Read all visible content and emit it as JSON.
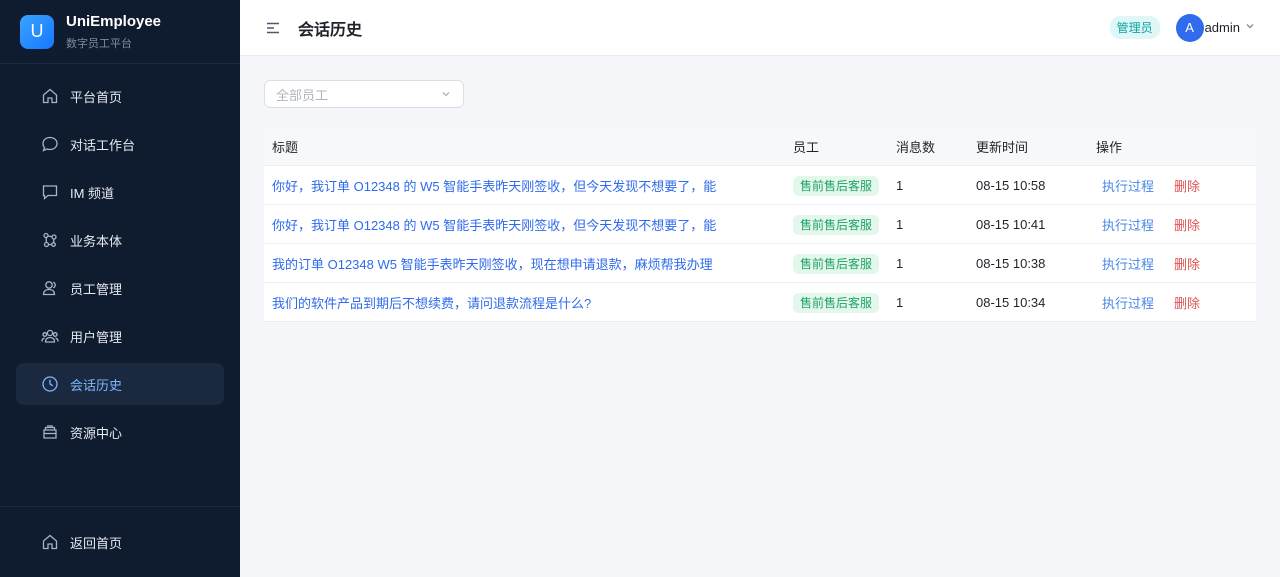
{
  "brand": {
    "logo_letter": "U",
    "name": "UniEmployee",
    "subtitle": "数字员工平台"
  },
  "sidebar": {
    "items": [
      {
        "label": "平台首页",
        "icon": "home-icon"
      },
      {
        "label": "对话工作台",
        "icon": "chat-bubble-icon"
      },
      {
        "label": "IM 频道",
        "icon": "message-square-icon"
      },
      {
        "label": "业务本体",
        "icon": "graph-nodes-icon"
      },
      {
        "label": "员工管理",
        "icon": "user-icon"
      },
      {
        "label": "用户管理",
        "icon": "users-icon"
      },
      {
        "label": "会话历史",
        "icon": "clock-icon",
        "active": true
      },
      {
        "label": "资源中心",
        "icon": "archive-icon"
      }
    ],
    "bottom": {
      "label": "返回首页",
      "icon": "home-icon"
    }
  },
  "header": {
    "title": "会话历史",
    "role_badge": "管理员",
    "avatar_letter": "A",
    "username": "admin"
  },
  "filter": {
    "placeholder": "全部员工"
  },
  "table": {
    "columns": [
      "标题",
      "员工",
      "消息数",
      "更新时间",
      "操作"
    ],
    "rows": [
      {
        "title": "你好，我订单 O12348 的 W5 智能手表昨天刚签收，但今天发现不想要了，能",
        "employee": "售前售后客服",
        "count": "1",
        "time": "08-15 10:58",
        "op_view": "执行过程",
        "op_delete": "删除"
      },
      {
        "title": "你好，我订单 O12348 的 W5 智能手表昨天刚签收，但今天发现不想要了，能",
        "employee": "售前售后客服",
        "count": "1",
        "time": "08-15 10:41",
        "op_view": "执行过程",
        "op_delete": "删除"
      },
      {
        "title": "我的订单 O12348 W5 智能手表昨天刚签收，现在想申请退款，麻烦帮我办理",
        "employee": "售前售后客服",
        "count": "1",
        "time": "08-15 10:38",
        "op_view": "执行过程",
        "op_delete": "删除"
      },
      {
        "title": "我们的软件产品到期后不想续费，请问退款流程是什么?",
        "employee": "售前售后客服",
        "count": "1",
        "time": "08-15 10:34",
        "op_view": "执行过程",
        "op_delete": "删除"
      }
    ]
  },
  "colors": {
    "sidebar_bg": "#0f1b2e",
    "accent": "#2f6bec",
    "danger": "#e05252",
    "tag_green": "#21a366",
    "role_teal": "#0aa3a3"
  }
}
